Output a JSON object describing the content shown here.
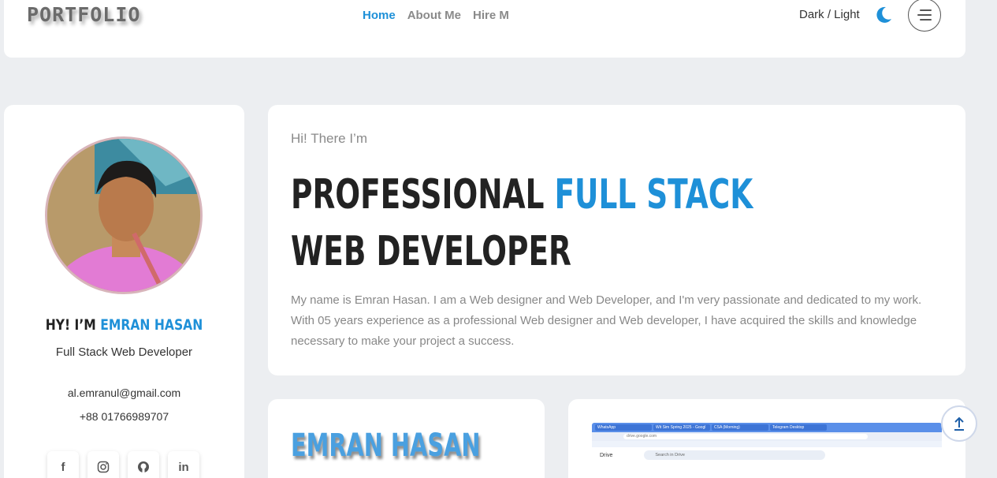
{
  "nav": {
    "logo": "PORTFOLIO",
    "links": [
      "Home",
      "About Me",
      "Hire M"
    ],
    "theme_label": "Dark / Light",
    "accent": "#1e90d8"
  },
  "profile": {
    "greeting_prefix": "HY! I’M ",
    "name": "EMRAN HASAN",
    "role": "Full Stack Web Developer",
    "email": "al.emranul@gmail.com",
    "phone": "+88 01766989707",
    "socials": [
      {
        "icon": "facebook-icon",
        "glyph": "f"
      },
      {
        "icon": "instagram-icon",
        "glyph": ""
      },
      {
        "icon": "github-icon",
        "glyph": ""
      },
      {
        "icon": "linkedin-icon",
        "glyph": "in"
      }
    ]
  },
  "hero": {
    "greeting": "Hi! There I’m",
    "title_part1": "PROFESSIONAL ",
    "title_highlight": "FULL STACK",
    "title_line2": "WEB DEVELOPER",
    "bio": "My name is Emran Hasan. I am a Web designer and Web Developer, and I'm very passionate and dedicated to my work. With 05 years experience as a professional Web designer and Web developer, I have acquired the skills and knowledge necessary to make your project a success."
  },
  "namecard": {
    "name": "EMRAN HASAN"
  },
  "screenshot": {
    "tabs": [
      "WhatsApp",
      "Wit Sim Spring 2025 - Googl",
      "CSA (Morning)",
      "Telegram Desktop"
    ],
    "url": "drive.google.com",
    "app_name": "Drive",
    "search_placeholder": "Search in Drive"
  }
}
